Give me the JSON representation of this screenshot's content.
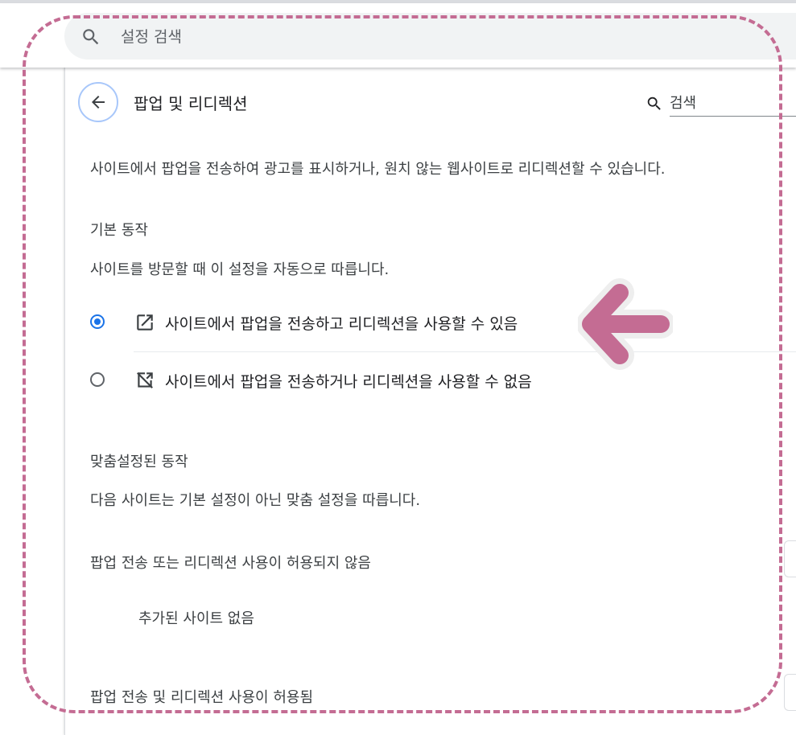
{
  "search": {
    "placeholder": "설정 검색"
  },
  "header": {
    "title": "팝업 및 리디렉션",
    "sub_search_placeholder": "검색"
  },
  "description": "사이트에서 팝업을 전송하여 광고를 표시하거나, 원치 않는 웹사이트로 리디렉션할 수 있습니다.",
  "default_behavior": {
    "heading": "기본 동작",
    "subtitle": "사이트를 방문할 때 이 설정을 자동으로 따릅니다.",
    "options": [
      {
        "label": "사이트에서 팝업을 전송하고 리디렉션을 사용할 수 있음",
        "icon": "open-in-new-icon",
        "selected": true
      },
      {
        "label": "사이트에서 팝업을 전송하거나 리디렉션을 사용할 수 없음",
        "icon": "open-in-new-off-icon",
        "selected": false
      }
    ]
  },
  "custom_behavior": {
    "heading": "맞춤설정된 동작",
    "subtitle": "다음 사이트는 기본 설정이 아닌 맞춤 설정을 따릅니다.",
    "blocked_heading": "팝업 전송 또는 리디렉션 사용이 허용되지 않음",
    "blocked_empty": "추가된 사이트 없음",
    "allowed_heading": "팝업 전송 및 리디렉션 사용이 허용됨"
  },
  "colors": {
    "accent": "#1a73e8",
    "annotation": "#c46c93",
    "text_primary": "#202124",
    "text_secondary": "#3c4043"
  }
}
